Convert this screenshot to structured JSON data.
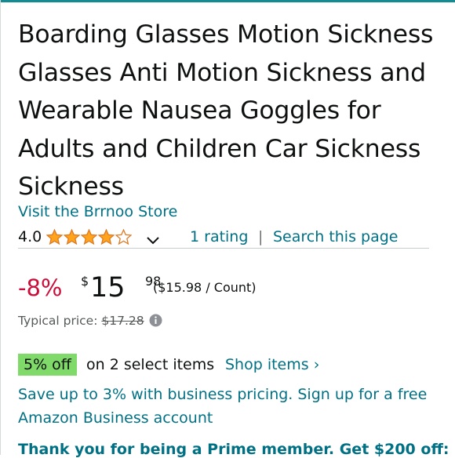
{
  "colors": {
    "link": "#007185",
    "discount": "#cc0c39",
    "star": "#ffa41c",
    "badge_bg": "#7fda69",
    "top_accent": "#138b93"
  },
  "product": {
    "title": "Boarding Glasses Motion Sickness Glasses Anti Motion Sickness and Wearable Nausea Goggles for Adults and Children Car Sickness Sickness",
    "store_link": "Visit the Brrnoo Store"
  },
  "rating": {
    "value": "4.0",
    "stars_filled": 4,
    "stars_total": 5,
    "dropdown_icon": "chevron-down-icon",
    "count_text": "1 rating",
    "separator": "|",
    "search_link": "Search this page"
  },
  "price": {
    "discount": "-8%",
    "currency": "$",
    "whole": "15",
    "fraction": "98",
    "per_unit": "($15.98 / Count)",
    "typical_label": "Typical price: ",
    "typical_value": "$17.28",
    "info_icon": "info-icon"
  },
  "coupon": {
    "badge": "5% off",
    "text": "on 2 select items",
    "link": "Shop items ›"
  },
  "business": {
    "text": "Save up to 3% with business pricing. Sign up for a free Amazon Business account"
  },
  "prime": {
    "text": "Thank you for being a Prime member. Get $200 off:"
  }
}
